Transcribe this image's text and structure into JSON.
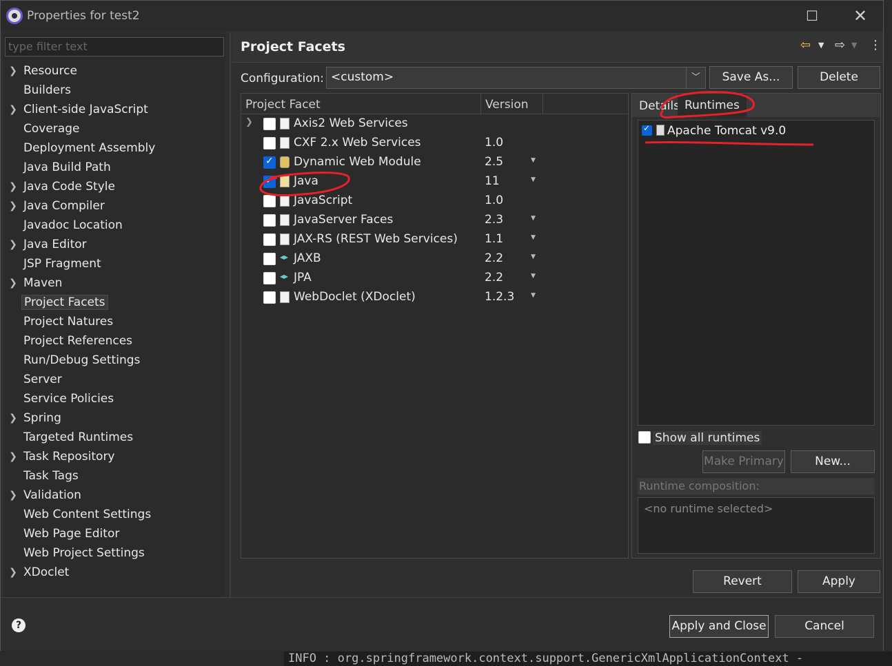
{
  "window": {
    "title": "Properties for test2"
  },
  "filter": {
    "placeholder": "type filter text"
  },
  "tree": [
    {
      "label": "Resource",
      "expandable": true
    },
    {
      "label": "Builders",
      "expandable": false
    },
    {
      "label": "Client-side JavaScript",
      "expandable": true
    },
    {
      "label": "Coverage",
      "expandable": false
    },
    {
      "label": "Deployment Assembly",
      "expandable": false
    },
    {
      "label": "Java Build Path",
      "expandable": false
    },
    {
      "label": "Java Code Style",
      "expandable": true
    },
    {
      "label": "Java Compiler",
      "expandable": true
    },
    {
      "label": "Javadoc Location",
      "expandable": false
    },
    {
      "label": "Java Editor",
      "expandable": true
    },
    {
      "label": "JSP Fragment",
      "expandable": false
    },
    {
      "label": "Maven",
      "expandable": true
    },
    {
      "label": "Project Facets",
      "expandable": false,
      "selected": true
    },
    {
      "label": "Project Natures",
      "expandable": false
    },
    {
      "label": "Project References",
      "expandable": false
    },
    {
      "label": "Run/Debug Settings",
      "expandable": false
    },
    {
      "label": "Server",
      "expandable": false
    },
    {
      "label": "Service Policies",
      "expandable": false
    },
    {
      "label": "Spring",
      "expandable": true
    },
    {
      "label": "Targeted Runtimes",
      "expandable": false
    },
    {
      "label": "Task Repository",
      "expandable": true
    },
    {
      "label": "Task Tags",
      "expandable": false
    },
    {
      "label": "Validation",
      "expandable": true
    },
    {
      "label": "Web Content Settings",
      "expandable": false
    },
    {
      "label": "Web Page Editor",
      "expandable": false
    },
    {
      "label": "Web Project Settings",
      "expandable": false
    },
    {
      "label": "XDoclet",
      "expandable": true
    }
  ],
  "header": {
    "title": "Project Facets"
  },
  "config": {
    "label": "Configuration:",
    "value": "<custom>",
    "save_as": "Save As...",
    "delete": "Delete"
  },
  "facets_table": {
    "col_facet": "Project Facet",
    "col_version": "Version",
    "rows": [
      {
        "name": "Axis2 Web Services",
        "version": "",
        "checked": false,
        "expandable": true,
        "icon": "page",
        "dropdown": false
      },
      {
        "name": "CXF 2.x Web Services",
        "version": "1.0",
        "checked": false,
        "icon": "page",
        "dropdown": false
      },
      {
        "name": "Dynamic Web Module",
        "version": "2.5",
        "checked": true,
        "icon": "gear",
        "dropdown": true
      },
      {
        "name": "Java",
        "version": "11",
        "checked": true,
        "icon": "java",
        "dropdown": true
      },
      {
        "name": "JavaScript",
        "version": "1.0",
        "checked": false,
        "icon": "page",
        "dropdown": false
      },
      {
        "name": "JavaServer Faces",
        "version": "2.3",
        "checked": false,
        "icon": "page",
        "dropdown": true
      },
      {
        "name": "JAX-RS (REST Web Services)",
        "version": "1.1",
        "checked": false,
        "icon": "page",
        "dropdown": true
      },
      {
        "name": "JAXB",
        "version": "2.2",
        "checked": false,
        "icon": "arrows",
        "dropdown": true
      },
      {
        "name": "JPA",
        "version": "2.2",
        "checked": false,
        "icon": "arrows",
        "dropdown": true
      },
      {
        "name": "WebDoclet (XDoclet)",
        "version": "1.2.3",
        "checked": false,
        "icon": "page",
        "dropdown": true
      }
    ]
  },
  "side_panel": {
    "tab_details": "Details",
    "tab_runtimes": "Runtimes",
    "runtime_name": "Apache Tomcat v9.0",
    "show_all": "Show all runtimes",
    "make_primary": "Make Primary",
    "new": "New...",
    "composition_label": "Runtime composition:",
    "composition_empty": "<no runtime selected>"
  },
  "actions": {
    "revert": "Revert",
    "apply": "Apply",
    "apply_close": "Apply and Close",
    "cancel": "Cancel",
    "help": "?"
  },
  "console": {
    "text": "INFO : org.springframework.context.support.GenericXmlApplicationContext -"
  },
  "colors": {
    "accent": "#0a64d8",
    "annotation": "#e8202a"
  }
}
